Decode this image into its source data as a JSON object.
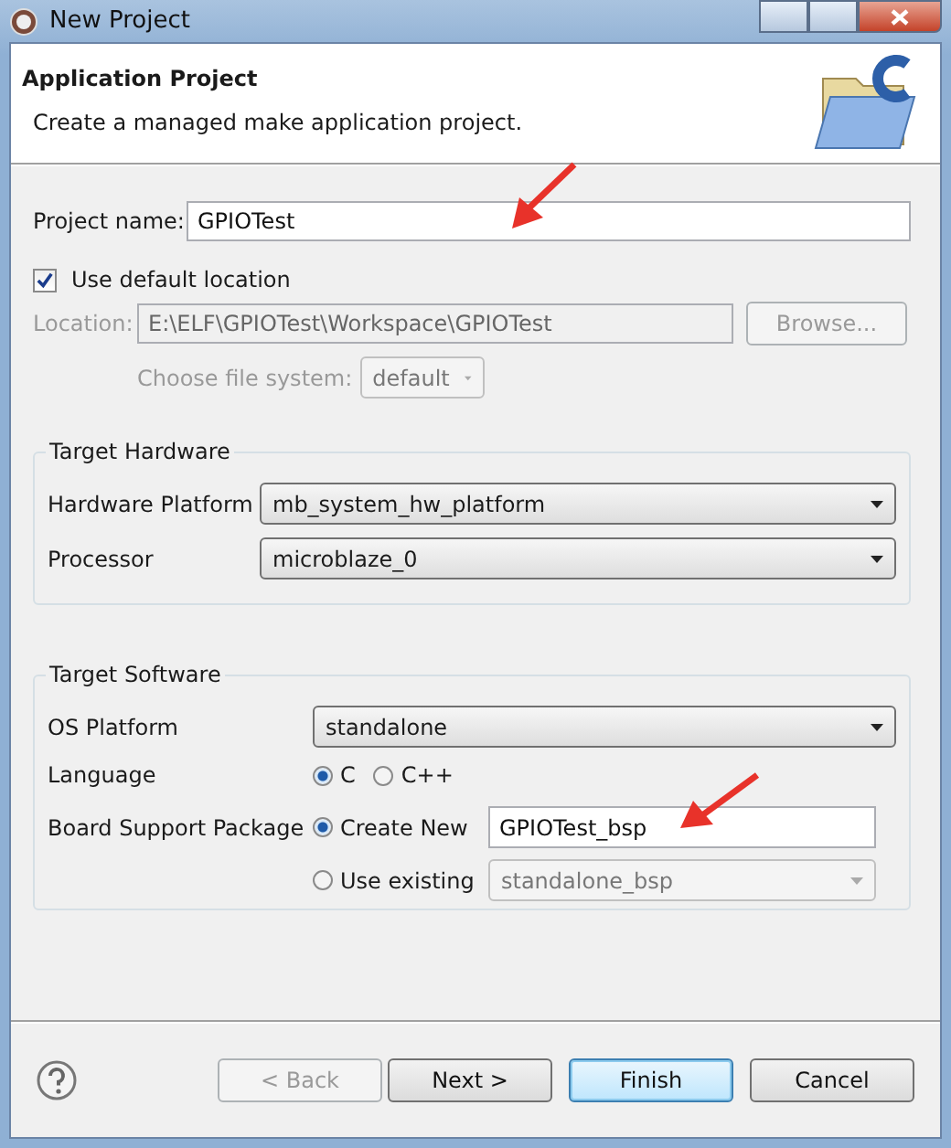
{
  "window": {
    "title": "New Project"
  },
  "header": {
    "title": "Application Project",
    "description": "Create a managed make application project."
  },
  "project": {
    "name_label": "Project name:",
    "name_value": "GPIOTest",
    "default_location": {
      "label": "Use default location",
      "checked": true
    },
    "location": {
      "label": "Location:",
      "value": "E:\\ELF\\GPIOTest\\Workspace\\GPIOTest",
      "disabled": true,
      "browse": "Browse..."
    },
    "file_system": {
      "label": "Choose file system:",
      "value": "default",
      "disabled": true
    }
  },
  "target_hardware": {
    "title": "Target Hardware",
    "rows": [
      {
        "label": "Hardware Platform",
        "value": "mb_system_hw_platform"
      },
      {
        "label": "Processor",
        "value": "microblaze_0"
      }
    ]
  },
  "target_software": {
    "title": "Target Software",
    "os_platform": {
      "label": "OS Platform",
      "value": "standalone"
    },
    "language": {
      "label": "Language",
      "options": [
        {
          "label": "C",
          "selected": true
        },
        {
          "label": "C++",
          "selected": false
        }
      ]
    },
    "bsp": {
      "label": "Board Support Package",
      "options": [
        {
          "label": "Create New",
          "selected": true,
          "kind": "input",
          "value": "GPIOTest_bsp"
        },
        {
          "label": "Use existing",
          "selected": false,
          "kind": "select",
          "value": "standalone_bsp"
        }
      ]
    }
  },
  "buttons": [
    {
      "label": "< Back",
      "disabled": true,
      "default": false
    },
    {
      "label": "Next >",
      "disabled": false,
      "default": false
    },
    {
      "label": "Finish",
      "disabled": false,
      "default": true
    },
    {
      "label": "Cancel",
      "disabled": false,
      "default": false
    }
  ]
}
